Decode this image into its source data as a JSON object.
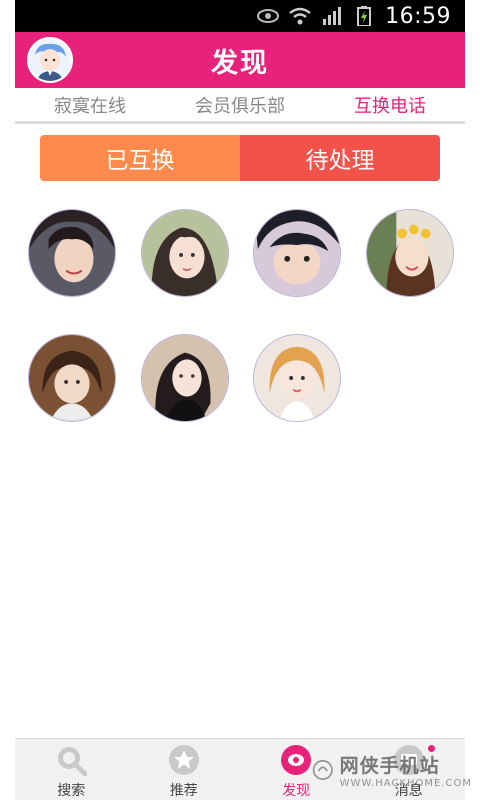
{
  "status_bar": {
    "time": "16:59"
  },
  "header": {
    "title": "发现"
  },
  "tabs": [
    {
      "label": "寂寞在线",
      "active": false
    },
    {
      "label": "会员俱乐部",
      "active": false
    },
    {
      "label": "互换电话",
      "active": true
    }
  ],
  "segmented": {
    "left_label": "已互换",
    "right_label": "待处理"
  },
  "profiles_count": 7,
  "bottom_nav": [
    {
      "label": "搜索",
      "icon": "search-icon"
    },
    {
      "label": "推荐",
      "icon": "star-icon"
    },
    {
      "label": "发现",
      "icon": "discover-icon",
      "active": true
    },
    {
      "label": "消息",
      "icon": "message-icon"
    }
  ],
  "watermark": {
    "text": "网侠手机站",
    "sub": "WWW.HACKHOME.COM"
  },
  "colors": {
    "accent": "#e8217a",
    "segment_left": "#ff8a4c",
    "segment_right": "#f2524a"
  }
}
